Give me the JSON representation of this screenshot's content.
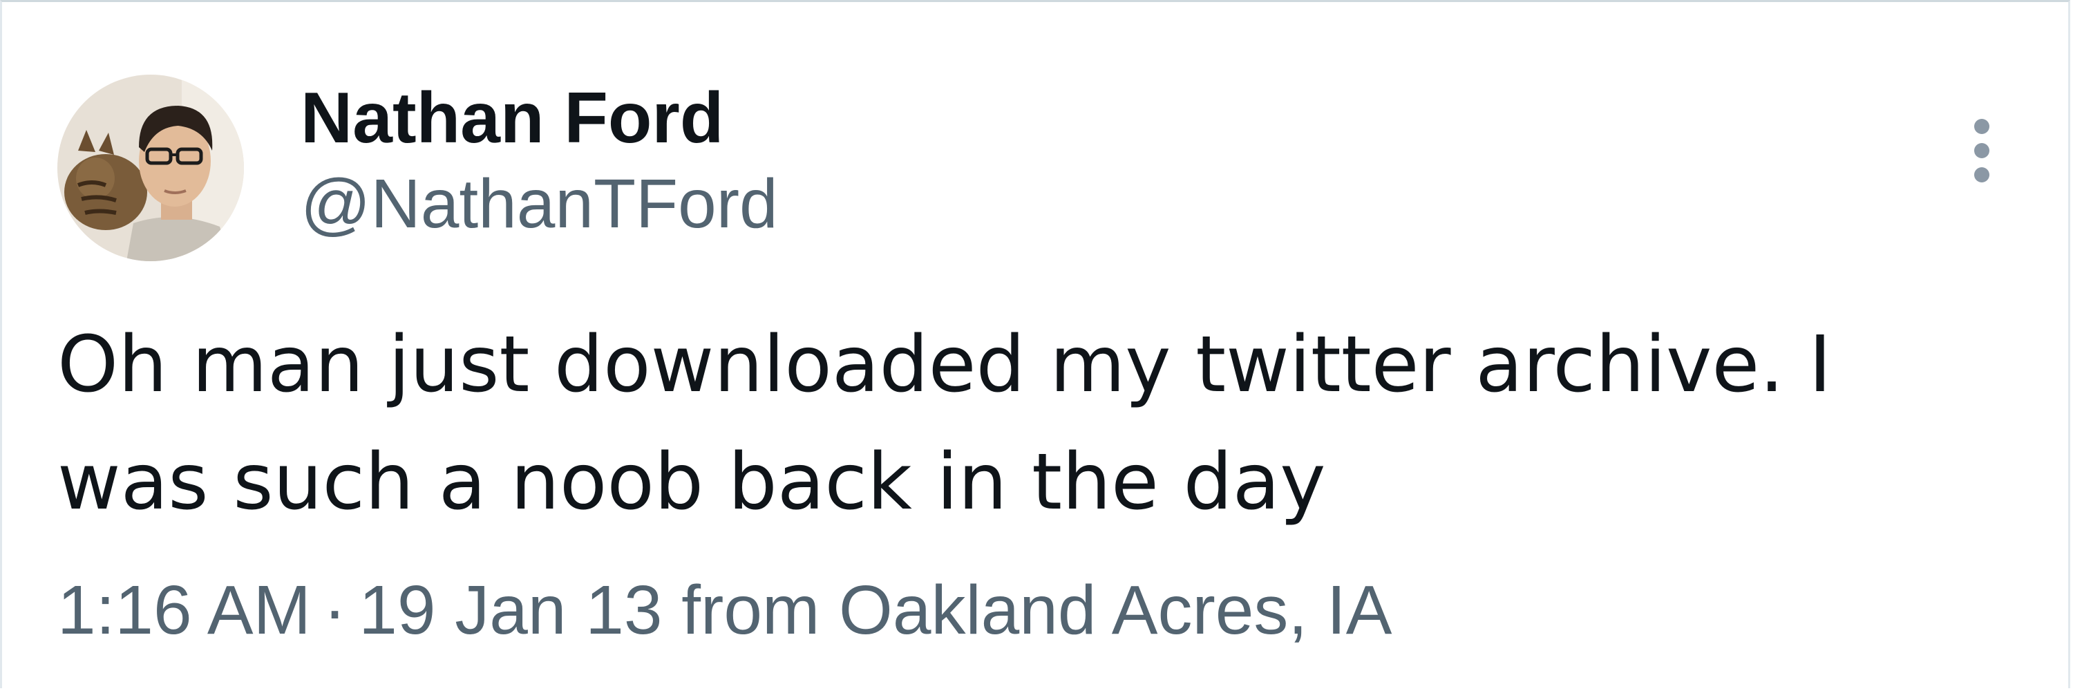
{
  "author": {
    "display_name": "Nathan Ford",
    "handle": "@NathanTFord",
    "avatar_icon": "profile-photo-with-cat"
  },
  "tweet": {
    "text": "Oh man just downloaded my twitter archive. I was such a noob back in the day",
    "time": "1:16 AM",
    "separator": "·",
    "date_location": "19 Jan 13 from Oakland Acres, IA"
  },
  "menu": {
    "icon": "more-vertical-icon"
  },
  "colors": {
    "primary_text": "#0f1419",
    "secondary_text": "#536471",
    "border": "#cfd9de",
    "icon": "#8b98a5"
  }
}
